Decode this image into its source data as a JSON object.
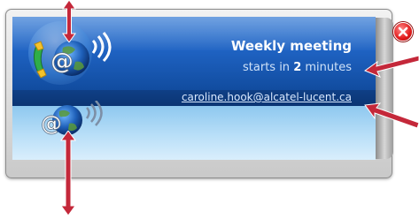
{
  "notification": {
    "title": "Weekly meeting",
    "countdown_prefix": "starts in ",
    "countdown_value": "2",
    "countdown_suffix": " minutes",
    "email": "caroline.hook@alcatel-lucent.ca"
  },
  "icons": {
    "top": "phone-at-globe-icon",
    "bottom": "at-globe-icon",
    "close": "close-icon"
  },
  "colors": {
    "top_card": "#1f63c3",
    "email_bar": "#0f3f86",
    "bottom_card": "#b9dff8",
    "annotation_arrow": "#c4283a",
    "close_button": "#e21b1b"
  }
}
